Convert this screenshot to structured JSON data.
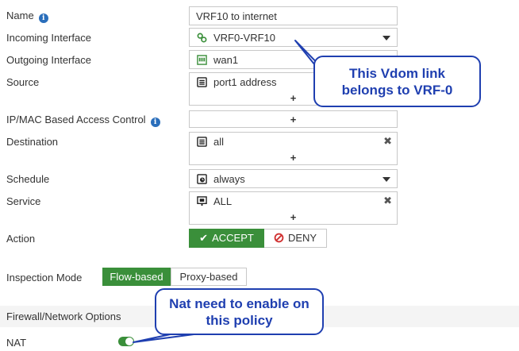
{
  "form": {
    "name_label": "Name",
    "name_value": "VRF10 to internet",
    "incoming_label": "Incoming Interface",
    "incoming_value": "VRF0-VRF10",
    "outgoing_label": "Outgoing Interface",
    "outgoing_value": "wan1",
    "source_label": "Source",
    "source_value": "port1 address",
    "ipmac_label": "IP/MAC Based Access Control",
    "destination_label": "Destination",
    "destination_value": "all",
    "schedule_label": "Schedule",
    "schedule_value": "always",
    "service_label": "Service",
    "service_value": "ALL",
    "action_label": "Action",
    "accept_label": "ACCEPT",
    "deny_label": "DENY",
    "inspection_label": "Inspection Mode",
    "flow_label": "Flow-based",
    "proxy_label": "Proxy-based",
    "plus": "+",
    "remove": "✖"
  },
  "section": {
    "title": "Firewall/Network Options"
  },
  "nat": {
    "label": "NAT",
    "enabled": true
  },
  "callouts": {
    "vdom_link": [
      "This Vdom link",
      "belongs to VRF-0"
    ],
    "nat_enable": [
      "Nat need to enable on",
      "this policy"
    ]
  },
  "colors": {
    "accept_green": "#3a8f3a",
    "selected_green": "#3a8f3a",
    "deny_red": "#d03030",
    "callout_blue": "#1f3fb0",
    "info_blue": "#2a6ebb"
  },
  "icons": {
    "incoming": "link-icon",
    "outgoing": "network-port-icon",
    "address": "address-list-icon",
    "schedule": "clock-icon",
    "service": "service-icon",
    "accept": "checkmark-icon",
    "deny": "block-icon"
  }
}
